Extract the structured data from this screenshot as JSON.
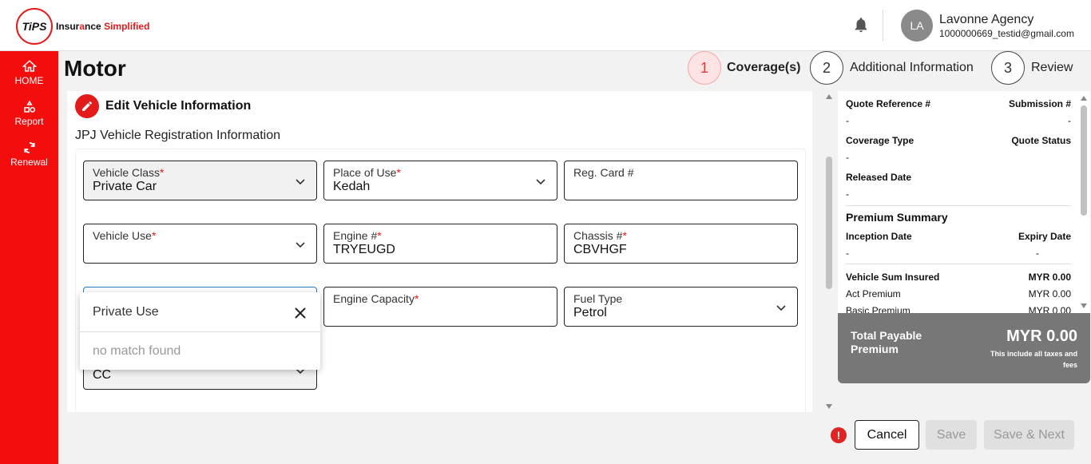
{
  "header": {
    "logo_mark": "TiPS",
    "logo_text_a": "Insur",
    "logo_text_b": "nce",
    "logo_text_c": "Simplified",
    "user_initials": "LA",
    "user_name": "Lavonne Agency",
    "user_email": "1000000669_testid@gmail.com"
  },
  "sidebar": {
    "items": [
      {
        "label": "HOME",
        "icon": "home-icon"
      },
      {
        "label": "Report",
        "icon": "report-icon"
      },
      {
        "label": "Renewal",
        "icon": "renewal-icon"
      }
    ]
  },
  "page": {
    "title": "Motor",
    "steps": [
      {
        "num": "1",
        "label": "Coverage(s)",
        "active": true
      },
      {
        "num": "2",
        "label": "Additional Information",
        "active": false
      },
      {
        "num": "3",
        "label": "Review",
        "active": false
      }
    ]
  },
  "form": {
    "edit_title": "Edit Vehicle Information",
    "section_title": "JPJ Vehicle Registration Information",
    "vehicle_class": {
      "label": "Vehicle Class",
      "value": "Private Car"
    },
    "place_of_use": {
      "label": "Place of Use",
      "value": "Kedah"
    },
    "reg_card": {
      "label": "Reg. Card #",
      "value": ""
    },
    "vehicle_use": {
      "label": "Vehicle Use",
      "value": ""
    },
    "engine_no": {
      "label": "Engine #",
      "value": "TRYEUGD"
    },
    "chassis_no": {
      "label": "Chassis #",
      "value": "CBVHGF"
    },
    "engine_capacity": {
      "label": "Engine Capacity",
      "value": ""
    },
    "fuel_type": {
      "label": "Fuel Type",
      "value": "Petrol"
    },
    "unit": {
      "value": "CC"
    },
    "required_mark": "*"
  },
  "dropdown": {
    "search_value": "Private Use",
    "empty_text": "no match found"
  },
  "summary": {
    "quote_ref_label": "Quote Reference #",
    "submission_label": "Submission #",
    "quote_ref_value": "-",
    "submission_value": "-",
    "coverage_type_label": "Coverage Type",
    "quote_status_label": "Quote Status",
    "coverage_type_value": "-",
    "released_date_label": "Released Date",
    "released_date_value": "-",
    "premium_summary_label": "Premium Summary",
    "inception_label": "Inception Date",
    "expiry_label": "Expiry Date",
    "inception_value": "-",
    "expiry_value": "-",
    "sum_insured_label": "Vehicle Sum Insured",
    "sum_insured_value": "MYR 0.00",
    "act_premium_label": "Act Premium",
    "act_premium_value": "MYR 0.00",
    "basic_premium_label": "Basic Premium",
    "basic_premium_value": "MYR 0.00"
  },
  "payable": {
    "label": "Total Payable Premium",
    "amount": "MYR 0.00",
    "note": "This include all taxes and fees"
  },
  "footer": {
    "cancel": "Cancel",
    "save": "Save",
    "save_next": "Save & Next"
  },
  "colors": {
    "brand": "#f40d0d",
    "accent": "#e31b1b",
    "focus": "#2a7bbf"
  }
}
